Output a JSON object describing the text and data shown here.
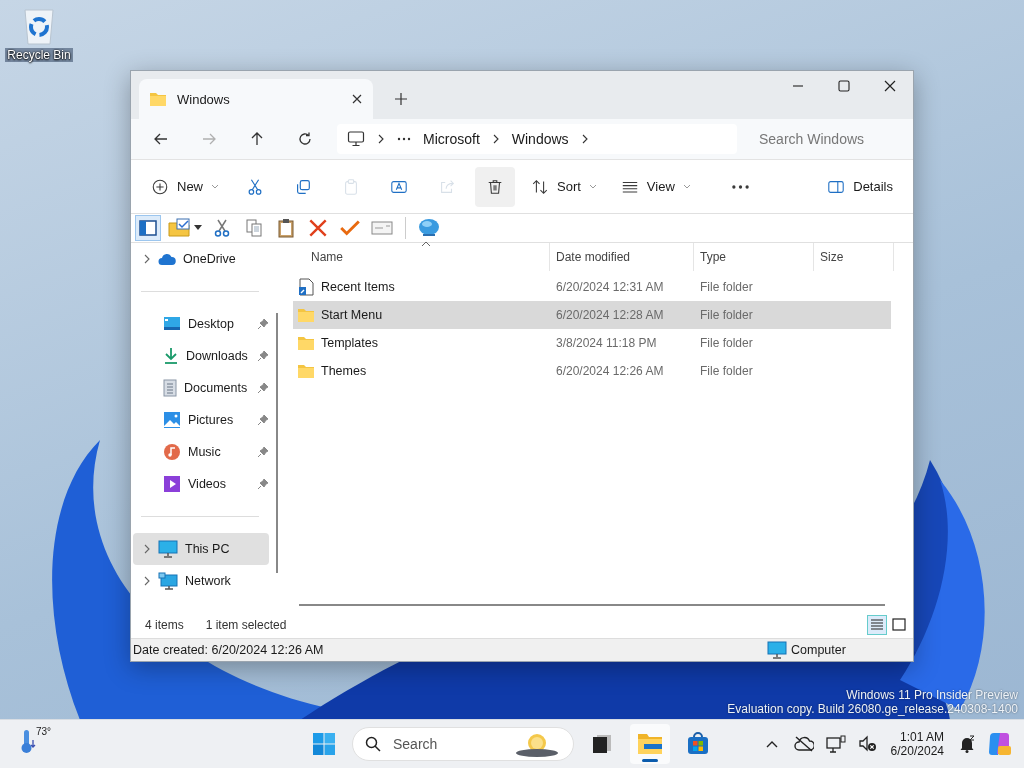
{
  "desktop": {
    "icons": [
      {
        "label": "Recycle Bin"
      }
    ],
    "watermark": [
      "Windows 11 Pro Insider Preview",
      "Evaluation copy. Build 26080.ge_release.240308-1400"
    ]
  },
  "window": {
    "tabs": [
      {
        "label": "Windows",
        "selected": true
      }
    ],
    "nav_buttons": [
      {
        "kind": "back",
        "disabled": false
      },
      {
        "kind": "forward",
        "disabled": true
      },
      {
        "kind": "up",
        "disabled": false
      },
      {
        "kind": "refresh",
        "disabled": false
      }
    ],
    "breadcrumb": {
      "items": [
        "Microsoft",
        "Windows"
      ]
    },
    "search": {
      "placeholder": "Search Windows"
    },
    "commands": [
      {
        "kind": "new",
        "label": "New",
        "menu": true,
        "disabled": false,
        "hovered": false
      },
      {
        "kind": "cut",
        "disabled": false,
        "hovered": false
      },
      {
        "kind": "copy",
        "disabled": false,
        "hovered": false
      },
      {
        "kind": "paste",
        "disabled": true,
        "hovered": false
      },
      {
        "kind": "rename",
        "disabled": false,
        "hovered": false
      },
      {
        "kind": "share",
        "disabled": true,
        "hovered": false
      },
      {
        "kind": "delete",
        "disabled": false,
        "hovered": true
      },
      {
        "kind": "sort",
        "label": "Sort",
        "menu": true,
        "disabled": false,
        "hovered": false
      },
      {
        "kind": "view",
        "label": "View",
        "menu": true,
        "disabled": false,
        "hovered": false
      },
      {
        "kind": "more",
        "disabled": false,
        "hovered": false
      },
      {
        "kind": "details",
        "label": "Details",
        "disabled": false,
        "hovered": false
      }
    ],
    "classic_toolbar": [
      {
        "kind": "pane",
        "pressed": true
      },
      {
        "kind": "folder-check",
        "pressed": false
      },
      {
        "kind": "cut",
        "pressed": false
      },
      {
        "kind": "copy",
        "pressed": false
      },
      {
        "kind": "paste",
        "pressed": false
      },
      {
        "kind": "delete",
        "pressed": false
      },
      {
        "kind": "check",
        "pressed": false
      },
      {
        "kind": "card",
        "pressed": false
      },
      {
        "kind": "globe",
        "pressed": false
      }
    ],
    "nav_pane": [
      {
        "items": [
          {
            "label": "OneDrive",
            "kind": "cloud",
            "expandable": true,
            "pinned": false,
            "selected": false
          }
        ]
      },
      {
        "items": [
          {
            "label": "Desktop",
            "kind": "desktop",
            "expandable": false,
            "pinned": true,
            "selected": false
          },
          {
            "label": "Downloads",
            "kind": "download",
            "expandable": false,
            "pinned": true,
            "selected": false
          },
          {
            "label": "Documents",
            "kind": "document",
            "expandable": false,
            "pinned": true,
            "selected": false
          },
          {
            "label": "Pictures",
            "kind": "picture",
            "expandable": false,
            "pinned": true,
            "selected": false
          },
          {
            "label": "Music",
            "kind": "music",
            "expandable": false,
            "pinned": true,
            "selected": false
          },
          {
            "label": "Videos",
            "kind": "video",
            "expandable": false,
            "pinned": true,
            "selected": false
          }
        ]
      },
      {
        "items": [
          {
            "label": "This PC",
            "kind": "pc",
            "expandable": true,
            "pinned": false,
            "selected": true
          },
          {
            "label": "Network",
            "kind": "network",
            "expandable": true,
            "pinned": false,
            "selected": false
          }
        ]
      }
    ],
    "columns": [
      {
        "label": "Name",
        "sorted": true
      },
      {
        "label": "Date modified",
        "sorted": false
      },
      {
        "label": "Type",
        "sorted": false
      },
      {
        "label": "Size",
        "sorted": false
      }
    ],
    "rows": [
      {
        "kind": "shortcut",
        "name": "Recent Items",
        "date": "6/20/2024 12:31 AM",
        "type": "File folder",
        "selected": false
      },
      {
        "kind": "folder",
        "name": "Start Menu",
        "date": "6/20/2024 12:28 AM",
        "type": "File folder",
        "selected": true
      },
      {
        "kind": "folder",
        "name": "Templates",
        "date": "3/8/2024 11:18 PM",
        "type": "File folder",
        "selected": false
      },
      {
        "kind": "folder",
        "name": "Themes",
        "date": "6/20/2024 12:26 AM",
        "type": "File folder",
        "selected": false
      }
    ],
    "status": {
      "count": "4 items",
      "selection": "1 item selected",
      "views": [
        {
          "kind": "details",
          "selected": true
        },
        {
          "kind": "tiles",
          "selected": false
        }
      ]
    },
    "info_bar": {
      "text": "Date created: 6/20/2024 12:26 AM",
      "location": "Computer"
    }
  },
  "taskbar": {
    "weather": {
      "temperature": "73°"
    },
    "search": {
      "placeholder": "Search"
    },
    "apps": [
      {
        "kind": "task-view",
        "active": false
      },
      {
        "kind": "explorer",
        "active": true
      },
      {
        "kind": "store",
        "active": false
      }
    ],
    "tray": [
      {
        "kind": "chevron"
      },
      {
        "kind": "cloud-off"
      },
      {
        "kind": "network"
      },
      {
        "kind": "volume-muted"
      }
    ],
    "clock": {
      "time": "1:01 AM",
      "date": "6/20/2024"
    }
  }
}
